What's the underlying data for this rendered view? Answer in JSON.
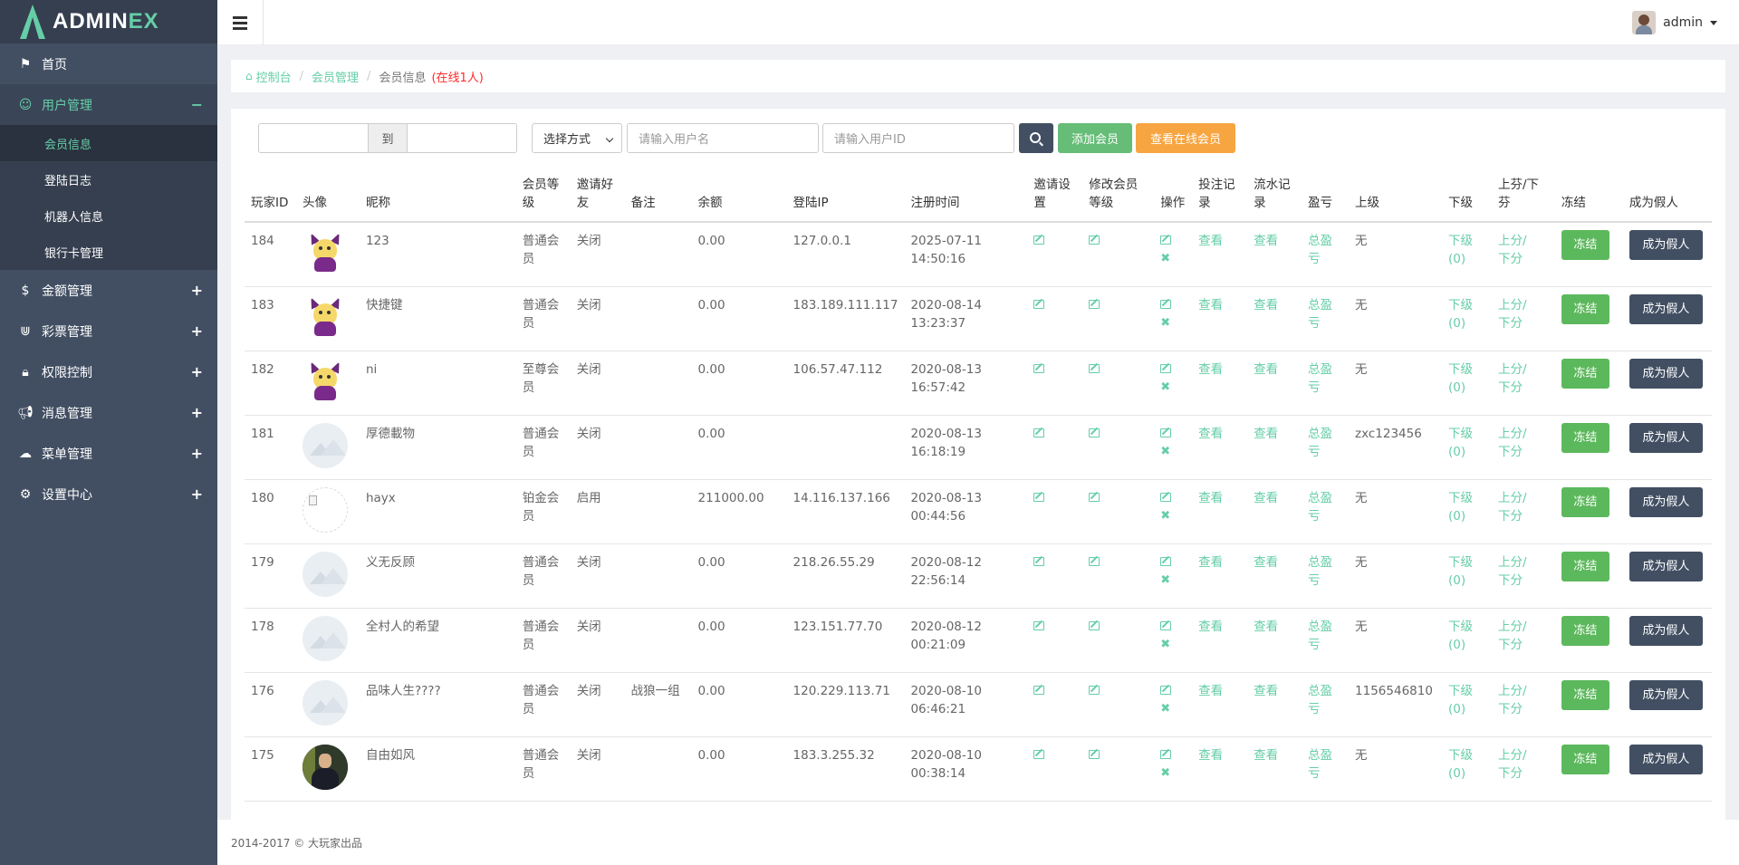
{
  "logo": {
    "main": "ADMIN",
    "accent": "EX"
  },
  "sidebar": {
    "items": [
      {
        "icon": "flag-icon",
        "label": "首页",
        "sign": ""
      },
      {
        "icon": "user-circle-icon",
        "label": "用户管理",
        "sign": "−"
      },
      {
        "icon": "dollar-icon",
        "label": "金额管理",
        "sign": "+"
      },
      {
        "icon": "magnet-icon",
        "label": "彩票管理",
        "sign": "+"
      },
      {
        "icon": "lock-icon",
        "label": "权限控制",
        "sign": "+"
      },
      {
        "icon": "bullhorn-icon",
        "label": "消息管理",
        "sign": "+"
      },
      {
        "icon": "cloud-icon",
        "label": "菜单管理",
        "sign": "+"
      },
      {
        "icon": "gear-icon",
        "label": "设置中心",
        "sign": "+"
      }
    ],
    "submenu": [
      "会员信息",
      "登陆日志",
      "机器人信息",
      "银行卡管理"
    ]
  },
  "header": {
    "username": "admin"
  },
  "breadcrumb": {
    "home": "控制台",
    "section": "会员管理",
    "current": "会员信息",
    "online": "(在线1人)"
  },
  "toolbar": {
    "to_label": "到",
    "select_label": "选择方式",
    "username_placeholder": "请输入用户名",
    "userid_placeholder": "请输入用户ID",
    "add_label": "添加会员",
    "online_label": "查看在线会员"
  },
  "table": {
    "headers": [
      "玩家ID",
      "头像",
      "昵称",
      "会员等级",
      "邀请好友",
      "备注",
      "余额",
      "登陆IP",
      "注册时间",
      "邀请设置",
      "修改会员等级",
      "操作",
      "投注记录",
      "流水记录",
      "盈亏",
      "上级",
      "下级",
      "上芬/下芬",
      "冻结",
      "成为假人"
    ],
    "action_labels": {
      "view": "查看",
      "profit": "总盈亏",
      "lower": "下级(0)",
      "upper": "上分/",
      "down": "下分",
      "freeze": "冻结",
      "fake": "成为假人"
    },
    "rows": [
      {
        "id": "184",
        "avatar": "devil",
        "nick": "123",
        "level": "普通会员",
        "invite": "关闭",
        "note": "",
        "balance": "0.00",
        "ip": "127.0.0.1",
        "date": "2025-07-11",
        "time": "14:50:16",
        "parent": "无"
      },
      {
        "id": "183",
        "avatar": "devil",
        "nick": "快捷键",
        "level": "普通会员",
        "invite": "关闭",
        "note": "",
        "balance": "0.00",
        "ip": "183.189.111.117",
        "date": "2020-08-14",
        "time": "13:23:37",
        "parent": "无"
      },
      {
        "id": "182",
        "avatar": "devil",
        "nick": "ni",
        "level": "至尊会员",
        "invite": "关闭",
        "note": "",
        "balance": "0.00",
        "ip": "106.57.47.112",
        "date": "2020-08-13",
        "time": "16:57:42",
        "parent": "无"
      },
      {
        "id": "181",
        "avatar": "placeholder",
        "nick": "厚德載物",
        "level": "普通会员",
        "invite": "关闭",
        "note": "",
        "balance": "0.00",
        "ip": "",
        "date": "2020-08-13",
        "time": "16:18:19",
        "parent": "zxc123456"
      },
      {
        "id": "180",
        "avatar": "blank",
        "nick": "hayx",
        "level": "铂金会员",
        "invite": "启用",
        "note": "",
        "balance": "211000.00",
        "ip": "14.116.137.166",
        "date": "2020-08-13",
        "time": "00:44:56",
        "parent": "无"
      },
      {
        "id": "179",
        "avatar": "placeholder",
        "nick": "义无反顾",
        "level": "普通会员",
        "invite": "关闭",
        "note": "",
        "balance": "0.00",
        "ip": "218.26.55.29",
        "date": "2020-08-12",
        "time": "22:56:14",
        "parent": "无"
      },
      {
        "id": "178",
        "avatar": "placeholder",
        "nick": "全村人的希望",
        "level": "普通会员",
        "invite": "关闭",
        "note": "",
        "balance": "0.00",
        "ip": "123.151.77.70",
        "date": "2020-08-12",
        "time": "00:21:09",
        "parent": "无"
      },
      {
        "id": "176",
        "avatar": "placeholder",
        "nick": "品味人生????",
        "level": "普通会员",
        "invite": "关闭",
        "note": "战狼一组",
        "balance": "0.00",
        "ip": "120.229.113.71",
        "date": "2020-08-10",
        "time": "06:46:21",
        "parent": "1156546810"
      },
      {
        "id": "175",
        "avatar": "photo",
        "nick": "自由如风",
        "level": "普通会员",
        "invite": "关闭",
        "note": "",
        "balance": "0.00",
        "ip": "183.3.255.32",
        "date": "2020-08-10",
        "time": "00:38:14",
        "parent": "无"
      }
    ]
  },
  "footer": {
    "text": "2014-2017 © 大玩家出品"
  }
}
